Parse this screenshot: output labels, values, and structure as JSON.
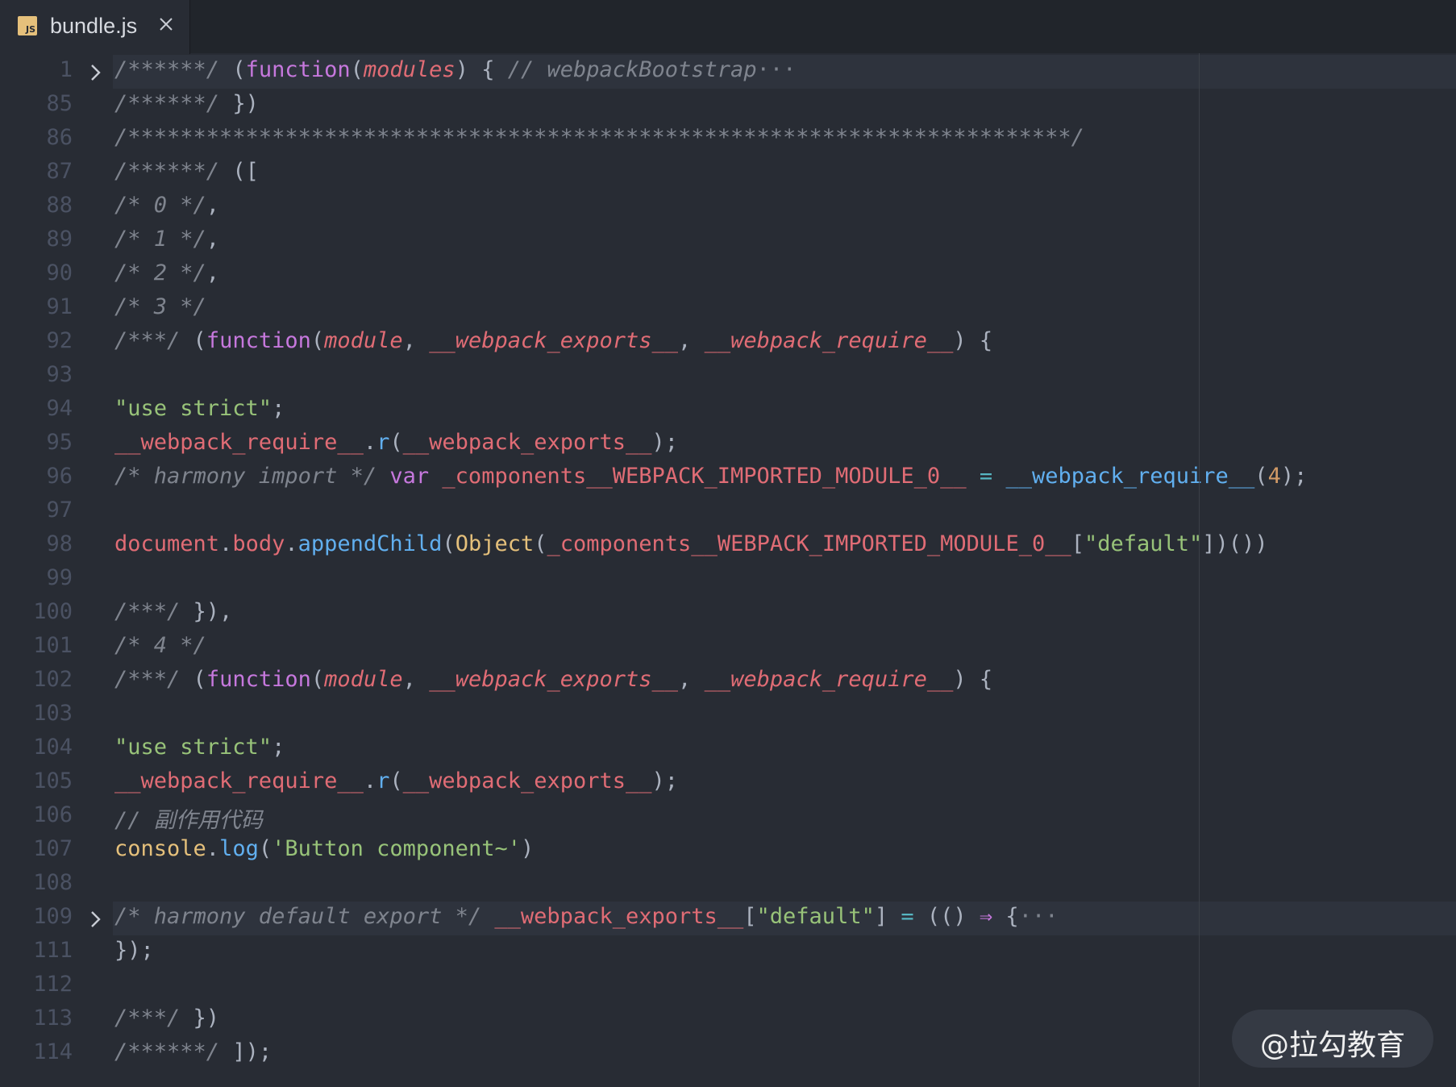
{
  "tab": {
    "title": "bundle.js",
    "icon": "js-file-icon",
    "icon_text": "JS"
  },
  "code_lines": [
    {
      "num": "1",
      "fold": true,
      "segs": [
        [
          "c",
          "/******/ "
        ],
        [
          "",
          "("
        ],
        [
          "k",
          "function"
        ],
        [
          "",
          "("
        ],
        [
          "p",
          "modules"
        ],
        [
          "",
          ") { "
        ],
        [
          "c",
          "// webpackBootstrap"
        ],
        [
          "x",
          "···"
        ]
      ]
    },
    {
      "num": "85",
      "segs": [
        [
          "c",
          "/******/ "
        ],
        [
          "",
          "})"
        ]
      ]
    },
    {
      "num": "86",
      "segs": [
        [
          "c",
          "/************************************************************************/"
        ]
      ]
    },
    {
      "num": "87",
      "segs": [
        [
          "c",
          "/******/ "
        ],
        [
          "",
          "(["
        ]
      ]
    },
    {
      "num": "88",
      "segs": [
        [
          "c",
          "/* 0 */"
        ],
        [
          "",
          ","
        ]
      ]
    },
    {
      "num": "89",
      "segs": [
        [
          "c",
          "/* 1 */"
        ],
        [
          "",
          ","
        ]
      ]
    },
    {
      "num": "90",
      "segs": [
        [
          "c",
          "/* 2 */"
        ],
        [
          "",
          ","
        ]
      ]
    },
    {
      "num": "91",
      "segs": [
        [
          "c",
          "/* 3 */"
        ]
      ]
    },
    {
      "num": "92",
      "segs": [
        [
          "c",
          "/***/ "
        ],
        [
          "",
          "("
        ],
        [
          "k",
          "function"
        ],
        [
          "",
          "("
        ],
        [
          "p",
          "module"
        ],
        [
          "",
          ", "
        ],
        [
          "p",
          "__webpack_exports__"
        ],
        [
          "",
          ", "
        ],
        [
          "p",
          "__webpack_require__"
        ],
        [
          "",
          ") {"
        ]
      ]
    },
    {
      "num": "93",
      "segs": []
    },
    {
      "num": "94",
      "segs": [
        [
          "s",
          "\"use strict\""
        ],
        [
          "",
          ";"
        ]
      ]
    },
    {
      "num": "95",
      "segs": [
        [
          "v",
          "__webpack_require__"
        ],
        [
          "",
          "."
        ],
        [
          "f",
          "r"
        ],
        [
          "",
          "("
        ],
        [
          "v",
          "__webpack_exports__"
        ],
        [
          "",
          ");"
        ]
      ]
    },
    {
      "num": "96",
      "segs": [
        [
          "c",
          "/* harmony import */ "
        ],
        [
          "k",
          "var"
        ],
        [
          "",
          " "
        ],
        [
          "v",
          "_components__WEBPACK_IMPORTED_MODULE_0__"
        ],
        [
          "",
          " "
        ],
        [
          "o",
          "="
        ],
        [
          "",
          " "
        ],
        [
          "f",
          "__webpack_require__"
        ],
        [
          "",
          "("
        ],
        [
          "n",
          "4"
        ],
        [
          "",
          ");"
        ]
      ]
    },
    {
      "num": "97",
      "segs": []
    },
    {
      "num": "98",
      "segs": [
        [
          "v",
          "document"
        ],
        [
          "",
          "."
        ],
        [
          "v",
          "body"
        ],
        [
          "",
          "."
        ],
        [
          "f",
          "appendChild"
        ],
        [
          "",
          "("
        ],
        [
          "y",
          "Object"
        ],
        [
          "",
          "("
        ],
        [
          "v",
          "_components__WEBPACK_IMPORTED_MODULE_0__"
        ],
        [
          "",
          "["
        ],
        [
          "s",
          "\"default\""
        ],
        [
          "",
          "])())"
        ]
      ]
    },
    {
      "num": "99",
      "segs": []
    },
    {
      "num": "100",
      "segs": [
        [
          "c",
          "/***/ "
        ],
        [
          "",
          "}),"
        ]
      ]
    },
    {
      "num": "101",
      "segs": [
        [
          "c",
          "/* 4 */"
        ]
      ]
    },
    {
      "num": "102",
      "segs": [
        [
          "c",
          "/***/ "
        ],
        [
          "",
          "("
        ],
        [
          "k",
          "function"
        ],
        [
          "",
          "("
        ],
        [
          "p",
          "module"
        ],
        [
          "",
          ", "
        ],
        [
          "p",
          "__webpack_exports__"
        ],
        [
          "",
          ", "
        ],
        [
          "p",
          "__webpack_require__"
        ],
        [
          "",
          ") {"
        ]
      ]
    },
    {
      "num": "103",
      "segs": []
    },
    {
      "num": "104",
      "segs": [
        [
          "s",
          "\"use strict\""
        ],
        [
          "",
          ";"
        ]
      ]
    },
    {
      "num": "105",
      "segs": [
        [
          "v",
          "__webpack_require__"
        ],
        [
          "",
          "."
        ],
        [
          "f",
          "r"
        ],
        [
          "",
          "("
        ],
        [
          "v",
          "__webpack_exports__"
        ],
        [
          "",
          ");"
        ]
      ]
    },
    {
      "num": "106",
      "segs": [
        [
          "c",
          "// 副作用代码"
        ]
      ]
    },
    {
      "num": "107",
      "segs": [
        [
          "y",
          "console"
        ],
        [
          "",
          "."
        ],
        [
          "f",
          "log"
        ],
        [
          "",
          "("
        ],
        [
          "s",
          "'Button component~'"
        ],
        [
          "",
          ")"
        ]
      ]
    },
    {
      "num": "108",
      "segs": []
    },
    {
      "num": "109",
      "fold": true,
      "segs": [
        [
          "c",
          "/* harmony default export */ "
        ],
        [
          "v",
          "__webpack_exports__"
        ],
        [
          "",
          "["
        ],
        [
          "s",
          "\"default\""
        ],
        [
          "",
          "] "
        ],
        [
          "o",
          "="
        ],
        [
          "",
          " (() "
        ],
        [
          "k",
          "⇒"
        ],
        [
          "",
          " {"
        ],
        [
          "x",
          "···"
        ]
      ]
    },
    {
      "num": "111",
      "segs": [
        [
          "",
          "});"
        ]
      ]
    },
    {
      "num": "112",
      "segs": []
    },
    {
      "num": "113",
      "segs": [
        [
          "c",
          "/***/ "
        ],
        [
          "",
          "})"
        ]
      ]
    },
    {
      "num": "114",
      "segs": [
        [
          "c",
          "/******/ "
        ],
        [
          "",
          "]);"
        ]
      ]
    }
  ],
  "watermark": "@拉勾教育",
  "colors": {
    "background": "#282c34",
    "tabbar": "#21252b",
    "comment": "#7f848e",
    "keyword": "#c678dd",
    "string": "#98c379",
    "variable": "#e06c75",
    "function": "#61afef",
    "class": "#e5c07b",
    "number": "#d19a66"
  }
}
